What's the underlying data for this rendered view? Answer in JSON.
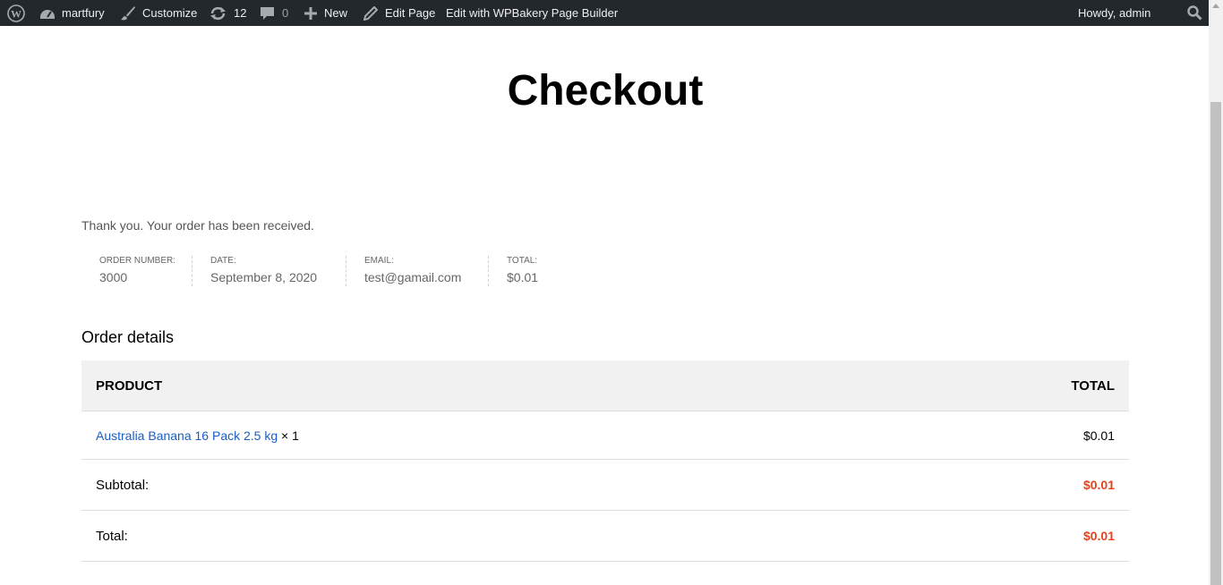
{
  "adminbar": {
    "site_name": "martfury",
    "customize": "Customize",
    "updates_count": "12",
    "comments_count": "0",
    "new_label": "New",
    "edit_page": "Edit Page",
    "wpbakery": "Edit with WPBakery Page Builder",
    "howdy": "Howdy, admin"
  },
  "page": {
    "title": "Checkout",
    "thank_you": "Thank you. Your order has been received."
  },
  "overview": [
    {
      "label": "ORDER NUMBER:",
      "value": "3000"
    },
    {
      "label": "DATE:",
      "value": "September 8, 2020"
    },
    {
      "label": "EMAIL:",
      "value": "test@gamail.com"
    },
    {
      "label": "TOTAL:",
      "value": "$0.01"
    }
  ],
  "order_details": {
    "title": "Order details",
    "headers": {
      "product": "PRODUCT",
      "total": "TOTAL"
    },
    "items": [
      {
        "name": "Australia Banana 16 Pack 2.5 kg",
        "qty": "× 1",
        "total": "$0.01"
      }
    ],
    "totals": [
      {
        "label": "Subtotal:",
        "value": "$0.01"
      },
      {
        "label": "Total:",
        "value": "$0.01"
      }
    ]
  },
  "colors": {
    "adminbar_bg": "#23282d",
    "link": "#1a5ec4",
    "price_accent": "#e9401c",
    "table_header_bg": "#f1f1f1"
  },
  "icons": [
    "wordpress-logo-icon",
    "dashboard-icon",
    "brush-icon",
    "updates-icon",
    "comment-icon",
    "plus-icon",
    "pencil-icon",
    "search-icon"
  ]
}
